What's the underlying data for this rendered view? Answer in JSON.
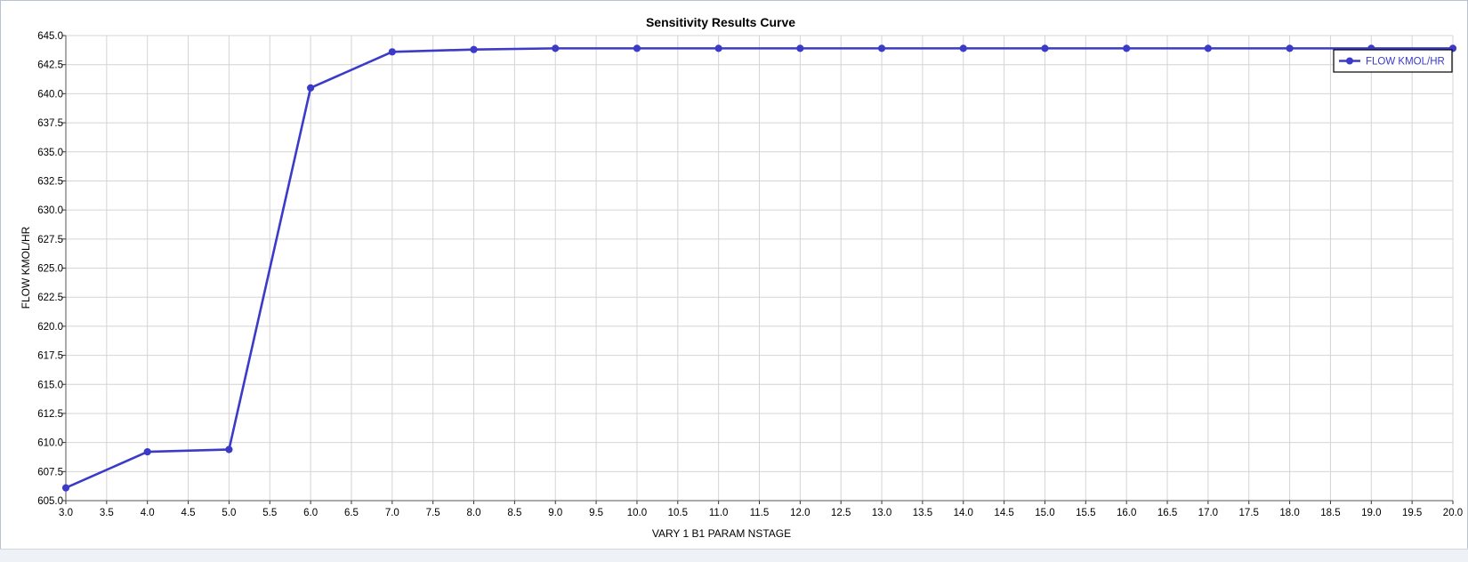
{
  "chart_data": {
    "type": "line",
    "title": "Sensitivity Results Curve",
    "xlabel": "VARY   1 B1 PARAM NSTAGE",
    "ylabel": "FLOW KMOL/HR",
    "xlim": [
      3.0,
      20.0
    ],
    "ylim": [
      605.0,
      645.0
    ],
    "x_ticks": [
      "3.0",
      "3.5",
      "4.0",
      "4.5",
      "5.0",
      "5.5",
      "6.0",
      "6.5",
      "7.0",
      "7.5",
      "8.0",
      "8.5",
      "9.0",
      "9.5",
      "10.0",
      "10.5",
      "11.0",
      "11.5",
      "12.0",
      "12.5",
      "13.0",
      "13.5",
      "14.0",
      "14.5",
      "15.0",
      "15.5",
      "16.0",
      "16.5",
      "17.0",
      "17.5",
      "18.0",
      "18.5",
      "19.0",
      "19.5",
      "20.0"
    ],
    "y_ticks": [
      "605.0",
      "607.5",
      "610.0",
      "612.5",
      "615.0",
      "617.5",
      "620.0",
      "622.5",
      "625.0",
      "627.5",
      "630.0",
      "632.5",
      "635.0",
      "637.5",
      "640.0",
      "642.5",
      "645.0"
    ],
    "grid": true,
    "legend_position": "top-right",
    "series": [
      {
        "name": "FLOW KMOL/HR",
        "color": "#3b3bc8",
        "x": [
          3,
          4,
          5,
          6,
          7,
          8,
          9,
          10,
          11,
          12,
          13,
          14,
          15,
          16,
          17,
          18,
          19,
          20
        ],
        "y": [
          606.1,
          609.2,
          609.4,
          640.5,
          643.6,
          643.8,
          643.9,
          643.9,
          643.9,
          643.9,
          643.9,
          643.9,
          643.9,
          643.9,
          643.9,
          643.9,
          643.9,
          643.9
        ]
      }
    ]
  }
}
